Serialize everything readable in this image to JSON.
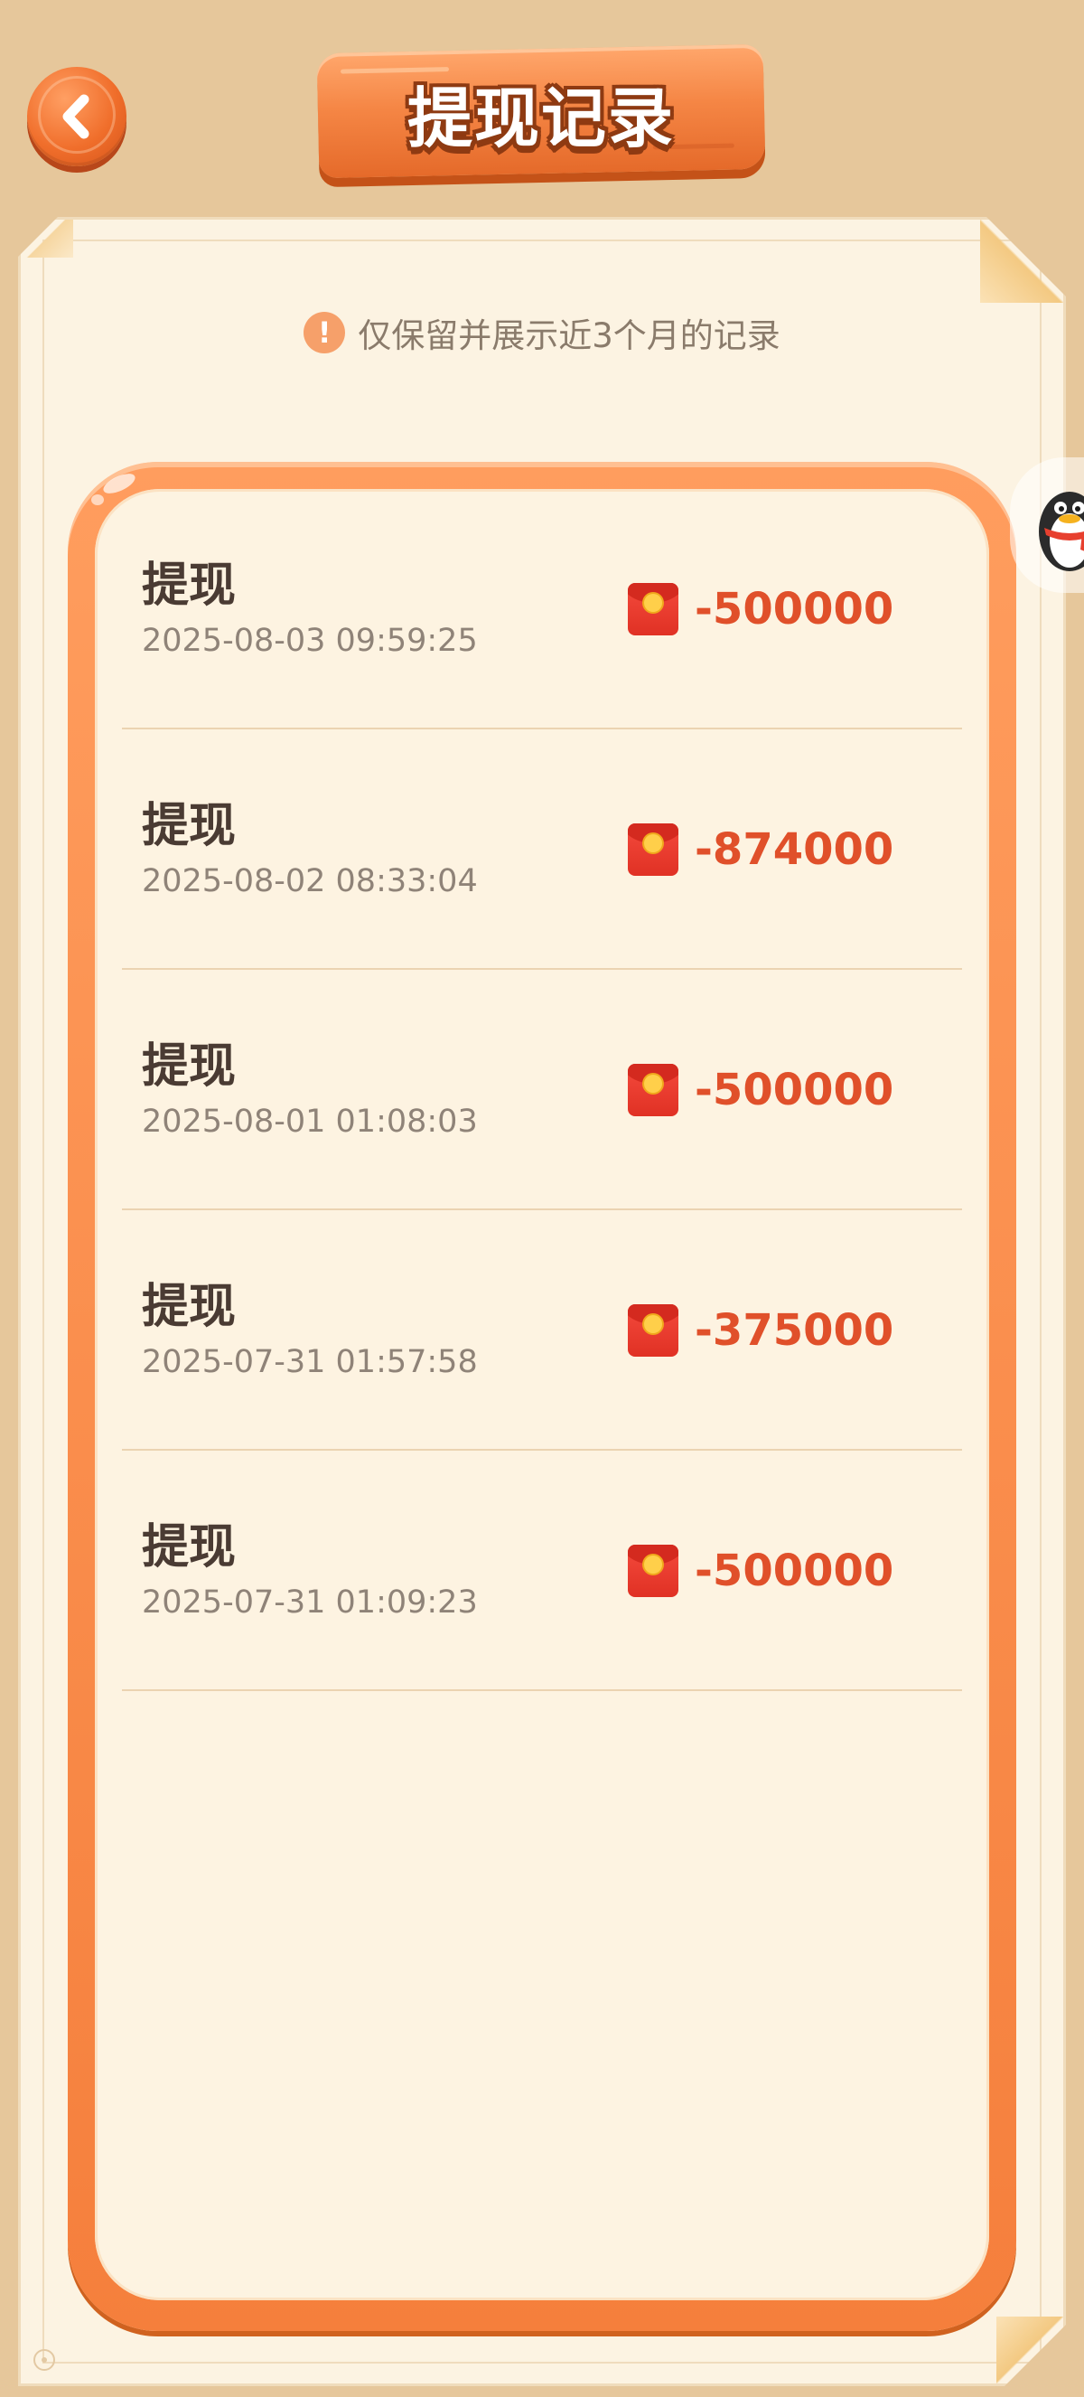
{
  "header": {
    "back_icon": "chevron-left-icon",
    "title": "提现记录"
  },
  "notice": {
    "icon": "exclamation-icon",
    "icon_glyph": "!",
    "text": "仅保留并展示近3个月的记录"
  },
  "records": [
    {
      "title": "提现",
      "time": "2025-08-03 09:59:25",
      "icon": "red-packet-icon",
      "amount": "-500000"
    },
    {
      "title": "提现",
      "time": "2025-08-02 08:33:04",
      "icon": "red-packet-icon",
      "amount": "-874000"
    },
    {
      "title": "提现",
      "time": "2025-08-01 01:08:03",
      "icon": "red-packet-icon",
      "amount": "-500000"
    },
    {
      "title": "提现",
      "time": "2025-07-31 01:57:58",
      "icon": "red-packet-icon",
      "amount": "-375000"
    },
    {
      "title": "提现",
      "time": "2025-07-31 01:09:23",
      "icon": "red-packet-icon",
      "amount": "-500000"
    }
  ],
  "floating_helper": {
    "icon": "penguin-icon"
  },
  "colors": {
    "background": "#e6c79b",
    "paper": "#fcf3e2",
    "accent_orange": "#f57f3c",
    "amount_red": "#e0502a",
    "title_text": "#4a3b33",
    "muted_text": "#8f8378"
  }
}
